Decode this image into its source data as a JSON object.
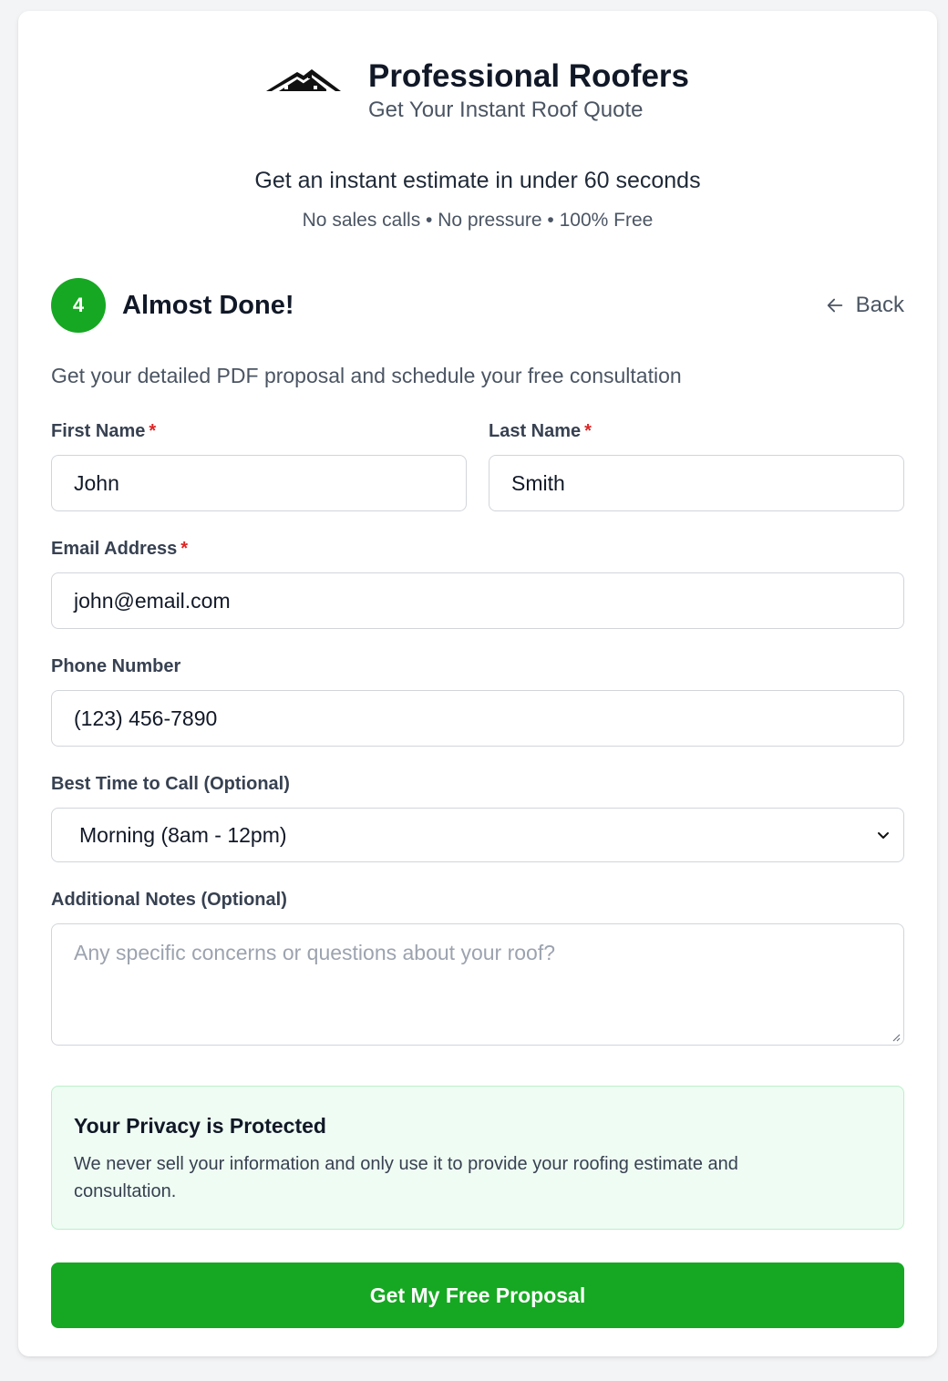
{
  "brand": {
    "name": "Professional Roofers",
    "subtitle": "Get Your Instant Roof Quote",
    "logo_icon": "house-roof-icon"
  },
  "hero": {
    "tagline": "Get an instant estimate in under 60 seconds",
    "subtagline": "No sales calls • No pressure • 100% Free"
  },
  "step": {
    "number": "4",
    "title": "Almost Done!",
    "back_label": "Back",
    "description": "Get your detailed PDF proposal and schedule your free consultation"
  },
  "form": {
    "first_name": {
      "label": "First Name",
      "required_mark": "*",
      "value": "John"
    },
    "last_name": {
      "label": "Last Name",
      "required_mark": "*",
      "value": "Smith"
    },
    "email": {
      "label": "Email Address",
      "required_mark": "*",
      "value": "john@email.com"
    },
    "phone": {
      "label": "Phone Number",
      "value": "(123) 456-7890"
    },
    "best_time": {
      "label": "Best Time to Call (Optional)",
      "selected": "Morning (8am - 12pm)"
    },
    "notes": {
      "label": "Additional Notes (Optional)",
      "placeholder": "Any specific concerns or questions about your roof?"
    }
  },
  "privacy": {
    "title": "Your Privacy is Protected",
    "body": "We never sell your information and only use it to provide your roofing estimate and consultation."
  },
  "submit_label": "Get My Free Proposal",
  "colors": {
    "accent": "#16a822",
    "privacy_bg": "#effcf3",
    "required": "#dc2626"
  }
}
